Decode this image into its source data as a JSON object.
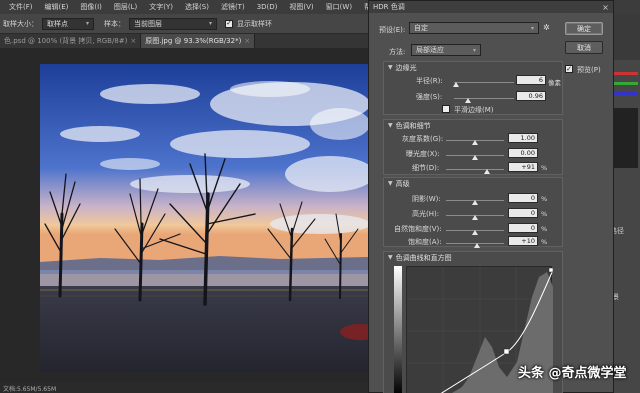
{
  "menubar": {
    "items": [
      "文件(F)",
      "编辑(E)",
      "图像(I)",
      "图层(L)",
      "文字(Y)",
      "选择(S)",
      "滤镜(T)",
      "3D(D)",
      "视图(V)",
      "窗口(W)",
      "帮助(H)"
    ]
  },
  "options": {
    "sample_size_label": "取样大小：",
    "sample_size_value": "取样点",
    "sample_label": "样本：",
    "sample_value": "当前图层",
    "show_ring_label": "显示取样环"
  },
  "tabs": [
    {
      "label": "色.psd @ 100% (背景 拷贝, RGB/8#)",
      "active": false
    },
    {
      "label": "原图.jpg @ 93.3%(RGB/32*)",
      "active": true
    }
  ],
  "statusbar": {
    "text": "文档:5.65M/5.65M"
  },
  "dialog": {
    "title": "HDR 色调",
    "preset_label": "预设(E):",
    "preset_value": "自定",
    "method_label": "方法:",
    "method_value": "局部适应",
    "ok_label": "确定",
    "cancel_label": "取消",
    "preview_label": "预览(P)",
    "preview_checked": true,
    "edge_glow": {
      "title": "边缘光",
      "radius_label": "半径(R):",
      "radius_value": "6",
      "radius_unit": "像素",
      "radius_level": 0.03,
      "strength_label": "强度(S):",
      "strength_value": "0.96",
      "strength_level": 0.24,
      "smooth_label": "平滑边缘(M)"
    },
    "tone_detail": {
      "title": "色调和细节",
      "gamma_label": "灰度系数(G):",
      "gamma_value": "1.00",
      "gamma_level": 0.5,
      "exposure_label": "曝光度(X):",
      "exposure_value": "0.00",
      "exposure_level": 0.5,
      "detail_label": "细节(D):",
      "detail_value": "+91",
      "detail_unit": "%",
      "detail_level": 0.7
    },
    "advanced": {
      "title": "高级",
      "shadow_label": "阴影(W):",
      "shadow_value": "0",
      "highlight_label": "高光(H):",
      "highlight_value": "0",
      "vibrance_label": "自然饱和度(V):",
      "vibrance_value": "0",
      "saturation_label": "饱和度(A):",
      "saturation_value": "+10",
      "unit": "%",
      "shadow_level": 0.5,
      "highlight_level": 0.5,
      "vibrance_level": 0.5,
      "saturation_level": 0.53
    },
    "curve": {
      "title": "色调曲线和直方图"
    }
  },
  "right_panel": {
    "tab_label": "路径",
    "layer_label": "景"
  },
  "watermark": {
    "text": "头条 @奇点微学堂"
  }
}
